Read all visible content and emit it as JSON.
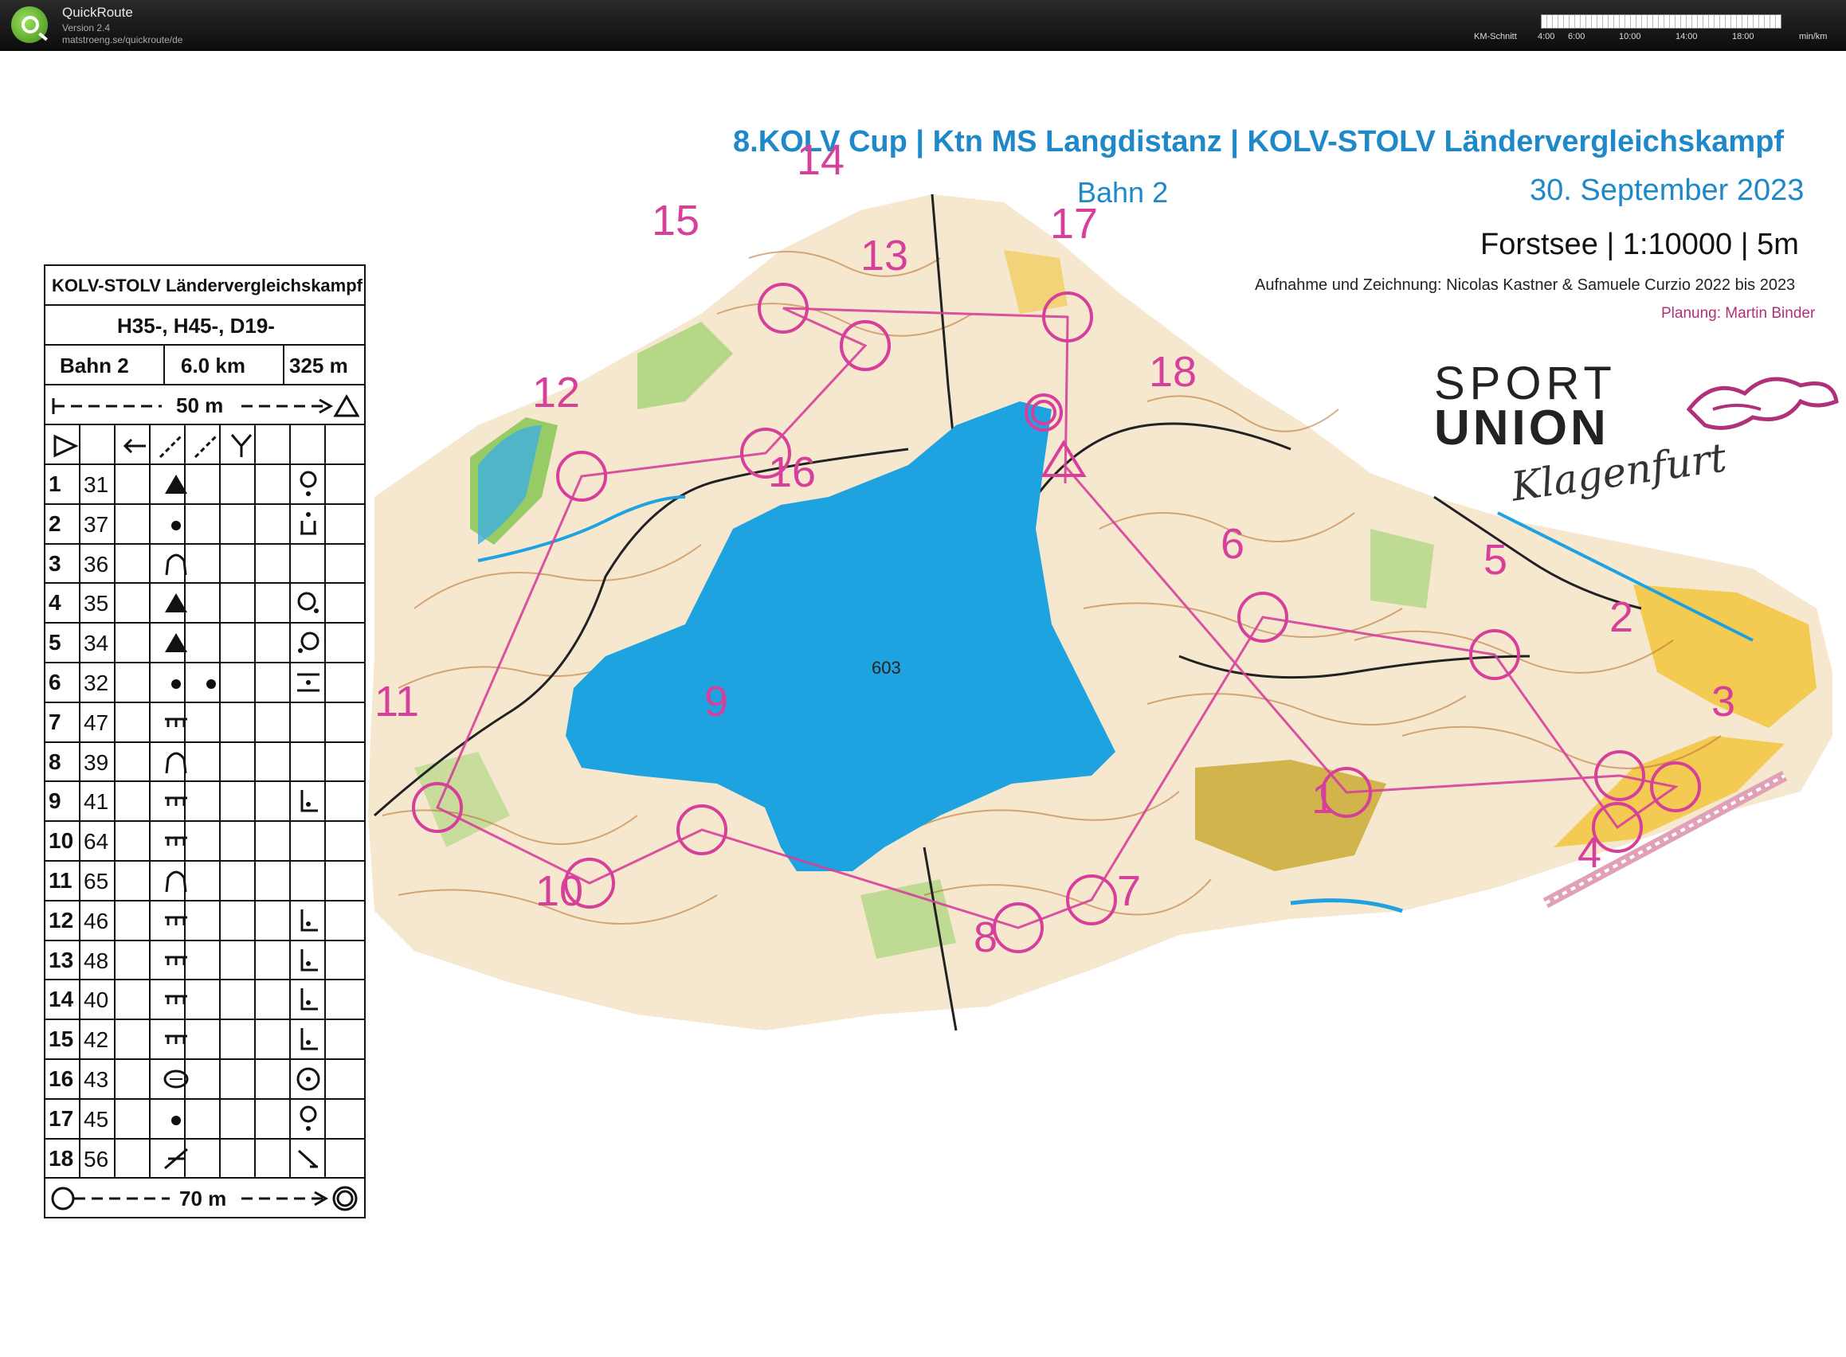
{
  "app": {
    "name": "QuickRoute",
    "version": "Version 2.4",
    "url": "matstroeng.se/quickroute/de"
  },
  "pace_scale": {
    "label": "KM-Schnitt",
    "ticks": [
      "4:00",
      "6:00",
      "10:00",
      "14:00",
      "18:00"
    ],
    "unit": "min/km"
  },
  "map_header": {
    "title": "8.KOLV Cup | Ktn MS Langdistanz | KOLV-STOLV Ländervergleichskampf",
    "course": "Bahn 2",
    "date": "30. September 2023",
    "info": "Forstsee | 1:10000 | 5m",
    "credits": "Aufnahme und Zeichnung: Nicolas Kastner & Samuele Curzio 2022 bis 2023",
    "planner": "Planung: Martin Binder"
  },
  "logo": {
    "line1": "SPORT",
    "line2": "UNION",
    "line3": "Klagenfurt"
  },
  "lake_height": "603",
  "colors": {
    "course": "#d6409a",
    "water": "#1fa3e0",
    "forest_green": "#7ec34a",
    "open_yellow": "#f2c53d",
    "contour_brown": "#b86b2a",
    "title_blue": "#1e88c8"
  },
  "controls": [
    {
      "n": "1",
      "code": "31"
    },
    {
      "n": "2",
      "code": "37"
    },
    {
      "n": "3",
      "code": "36"
    },
    {
      "n": "4",
      "code": "35"
    },
    {
      "n": "5",
      "code": "34"
    },
    {
      "n": "6",
      "code": "32"
    },
    {
      "n": "7",
      "code": "47"
    },
    {
      "n": "8",
      "code": "39"
    },
    {
      "n": "9",
      "code": "41"
    },
    {
      "n": "10",
      "code": "64"
    },
    {
      "n": "11",
      "code": "65"
    },
    {
      "n": "12",
      "code": "46"
    },
    {
      "n": "13",
      "code": "48"
    },
    {
      "n": "14",
      "code": "40"
    },
    {
      "n": "15",
      "code": "42"
    },
    {
      "n": "16",
      "code": "43"
    },
    {
      "n": "17",
      "code": "45"
    },
    {
      "n": "18",
      "code": "56"
    }
  ],
  "descriptions": {
    "event": "KOLV-STOLV Ländervergleichskampf",
    "classes": "H35-, H45-, D19-",
    "course": "Bahn 2",
    "length": "6.0 km",
    "climb": "325 m",
    "start_distance": "50 m",
    "finish_distance": "70 m"
  }
}
